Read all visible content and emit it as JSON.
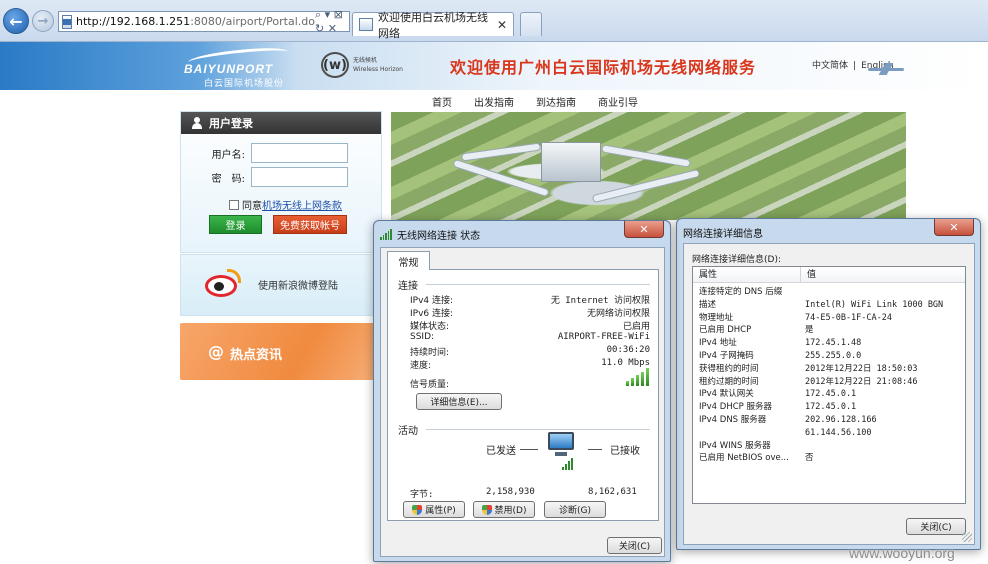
{
  "browser": {
    "url_host": "http://192.168.1.251",
    "url_rest": ":8080/airport/Portal.do",
    "address_tools": "⌕ ▾ ⊠ ↻ ✕",
    "active_tab_title": "欢迎使用白云机场无线网络",
    "tab_close": "✕",
    "back_icon": "arrow-left-icon",
    "forward_icon": "arrow-right-icon"
  },
  "site": {
    "logo_en": "BAIYUNPORT",
    "logo_cn": "白云国际机场股份",
    "wifi_mark": "(w)",
    "wifi_brand_cn": "无线候机",
    "wifi_brand_en": "Wireless Horizon",
    "welcome": "欢迎使用广州白云国际机场无线网络服务",
    "lang_cn": "中文简体",
    "lang_sep": "|",
    "lang_en": "English",
    "nav": [
      "首页",
      "出发指南",
      "到达指南",
      "商业引导"
    ]
  },
  "login": {
    "title": "用户登录",
    "username_label": "用户名:",
    "password_label": "密　码:",
    "agree_prefix": "同意",
    "agree_link": "机场无线上网条款",
    "login_button": "登录",
    "free_account_button": "免费获取帐号"
  },
  "weibo": {
    "label": "使用新浪微博登陆"
  },
  "hot": {
    "at": "@",
    "label": "热点资讯"
  },
  "status_dialog": {
    "title": "无线网络连接 状态",
    "tab": "常规",
    "connection_heading": "连接",
    "rows": [
      {
        "k": "IPv4 连接:",
        "v": "无 Internet 访问权限"
      },
      {
        "k": "IPv6 连接:",
        "v": "无网络访问权限"
      },
      {
        "k": "媒体状态:",
        "v": "已启用"
      },
      {
        "k": "SSID:",
        "v": "AIRPORT-FREE-WiFi"
      },
      {
        "k": "持续时间:",
        "v": "00:36:20"
      },
      {
        "k": "速度:",
        "v": "11.0 Mbps"
      }
    ],
    "signal_label": "信号质量:",
    "details_button": "详细信息(E)...",
    "activity_heading": "活动",
    "sent_label": "已发送",
    "recv_label": "已接收",
    "bytes_label": "字节:",
    "bytes_sent": "2,158,930",
    "bytes_recv": "8,162,631",
    "properties_button": "属性(P)",
    "disable_button": "禁用(D)",
    "diagnose_button": "诊断(G)",
    "close_button": "关闭(C)",
    "close_x": "✕"
  },
  "details_dialog": {
    "title": "网络连接详细信息",
    "caption": "网络连接详细信息(D):",
    "col_property": "属性",
    "col_value": "值",
    "rows": [
      {
        "p": "连接特定的 DNS 后缀",
        "v": ""
      },
      {
        "p": "描述",
        "v": "Intel(R) WiFi Link 1000 BGN"
      },
      {
        "p": "物理地址",
        "v": "74-E5-0B-1F-CA-24"
      },
      {
        "p": "已启用 DHCP",
        "v": "是"
      },
      {
        "p": "IPv4 地址",
        "v": "172.45.1.48"
      },
      {
        "p": "IPv4 子网掩码",
        "v": "255.255.0.0"
      },
      {
        "p": "获得租约的时间",
        "v": "2012年12月22日 18:50:03"
      },
      {
        "p": "租约过期的时间",
        "v": "2012年12月22日 21:08:46"
      },
      {
        "p": "IPv4 默认网关",
        "v": "172.45.0.1"
      },
      {
        "p": "IPv4 DHCP 服务器",
        "v": "172.45.0.1"
      },
      {
        "p": "IPv4 DNS 服务器",
        "v": "202.96.128.166"
      },
      {
        "p": "",
        "v": "61.144.56.100"
      },
      {
        "p": "IPv4 WINS 服务器",
        "v": ""
      },
      {
        "p": "已启用 NetBIOS ove...",
        "v": "否"
      }
    ],
    "close_button": "关闭(C)",
    "close_x": "✕"
  },
  "watermark": "www.wooyun.org"
}
